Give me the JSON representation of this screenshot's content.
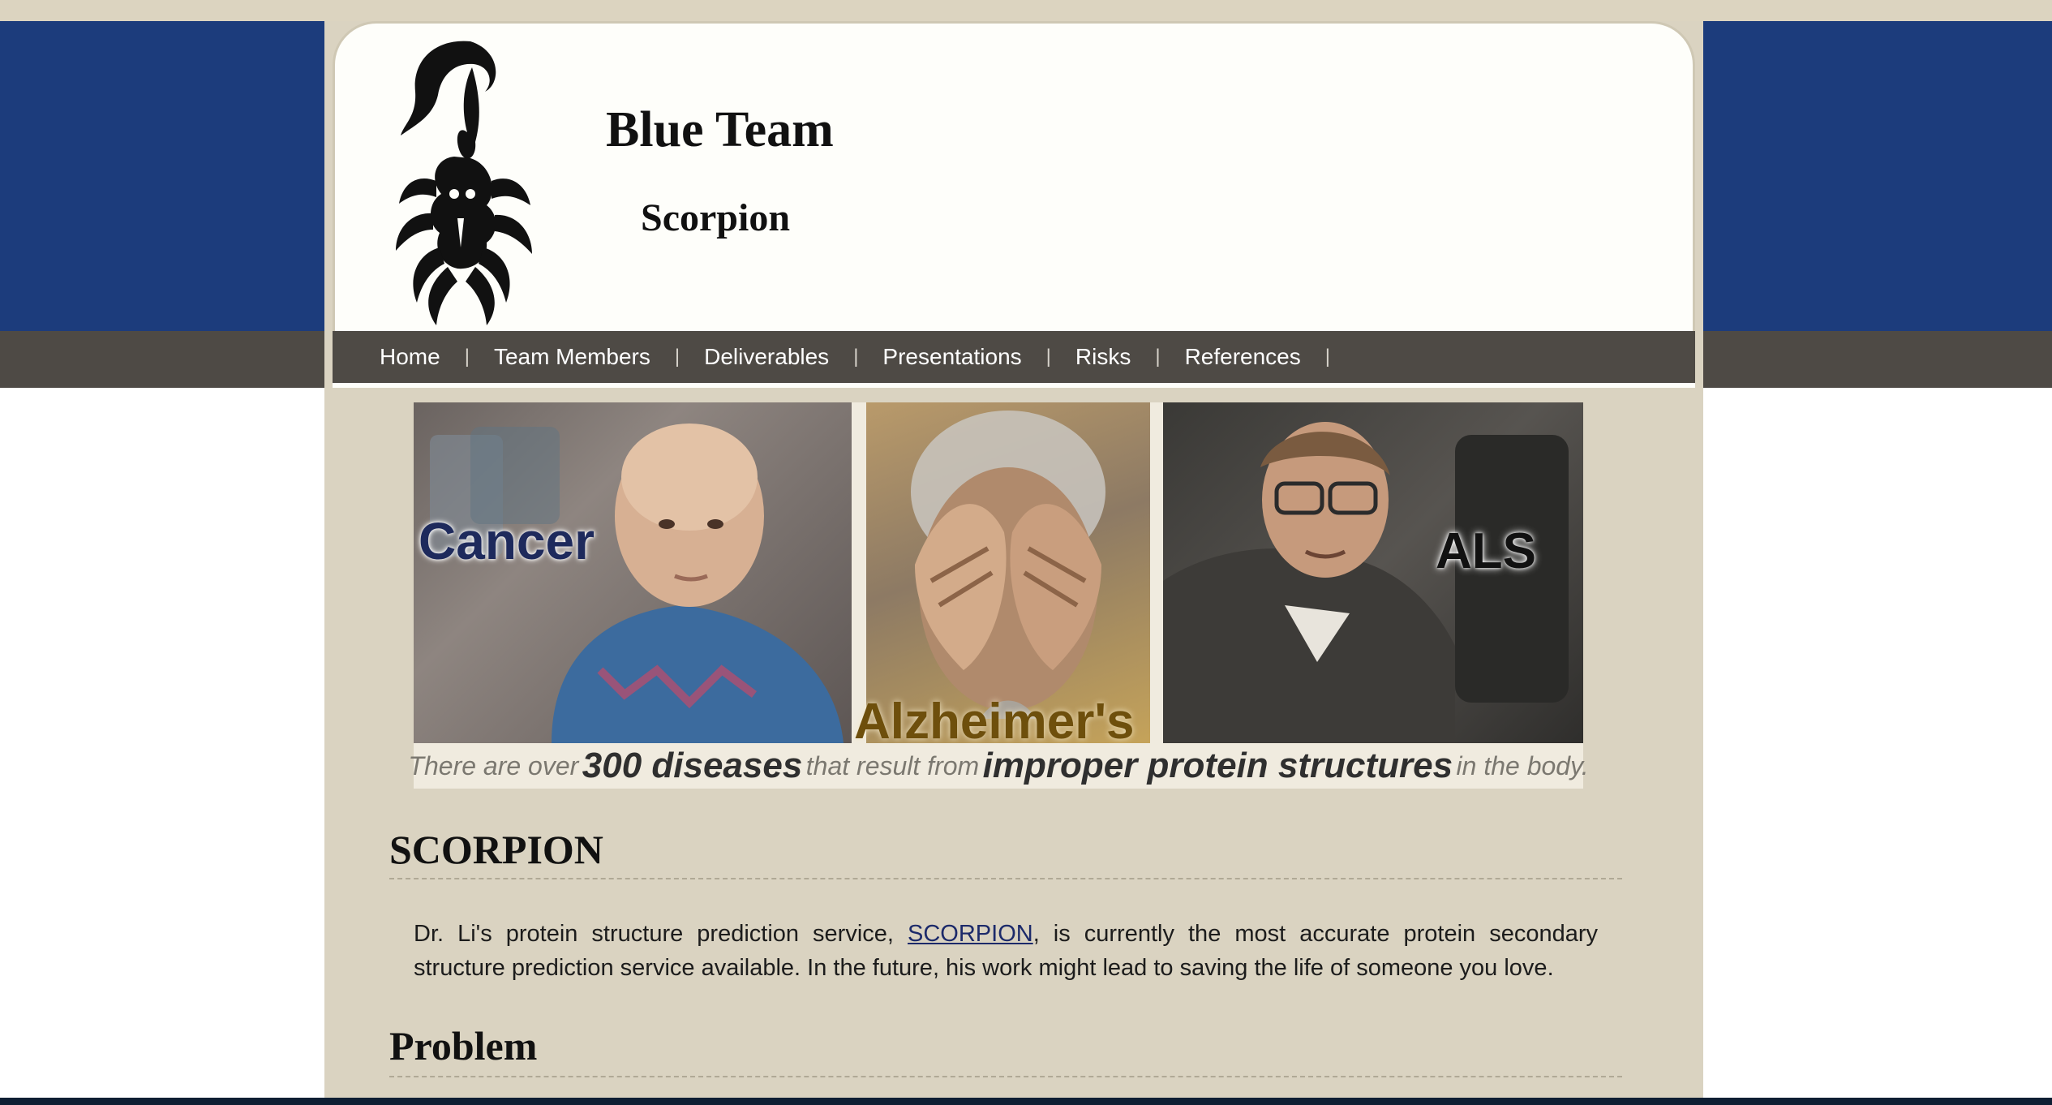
{
  "header": {
    "title": "Blue Team",
    "subtitle": "Scorpion"
  },
  "nav": {
    "items": [
      {
        "label": "Home"
      },
      {
        "label": "Team Members"
      },
      {
        "label": "Deliverables"
      },
      {
        "label": "Presentations"
      },
      {
        "label": "Risks"
      },
      {
        "label": "References"
      }
    ],
    "separator": "|"
  },
  "banner": {
    "labels": {
      "cancer": "Cancer",
      "alzheimers": "Alzheimer's",
      "als": "ALS"
    },
    "caption": {
      "part1": "There are over",
      "part2": "300 diseases",
      "part3": "that result from",
      "part4": "improper protein structures",
      "part5": "in the body."
    }
  },
  "section_scorpion": {
    "heading": "SCORPION",
    "text_before_link": "Dr. Li's protein structure prediction service, ",
    "link_text": "SCORPION",
    "text_after_link": ", is currently the most accurate protein secondary structure prediction service available. In the future, his work might lead to saving the life of someone you love."
  },
  "section_problem": {
    "heading": "Problem"
  },
  "colors": {
    "band_blue": "#1c3c7c",
    "nav_gray": "#4e4a45",
    "page_beige": "#dad3c1",
    "link_blue": "#1c2a6a"
  }
}
